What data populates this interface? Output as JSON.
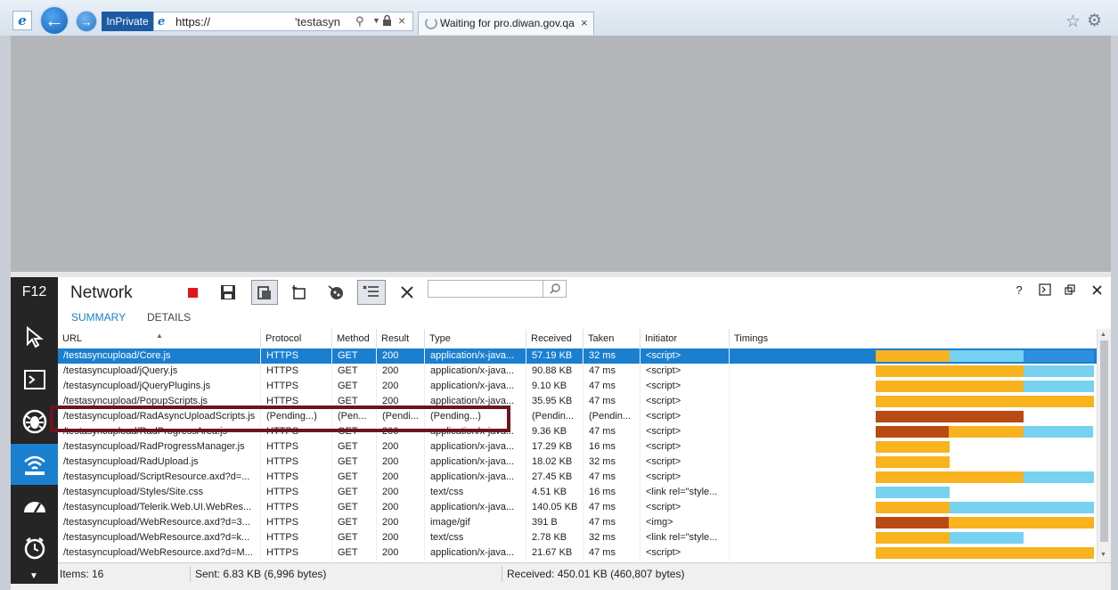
{
  "browser": {
    "url": "https://",
    "url_suffix": "'testasyncu",
    "inprivate_label": "InPrivate",
    "tab_title": "Waiting for pro.diwan.gov.qa",
    "tab_close": "×",
    "addr_close": "×"
  },
  "f12": {
    "label": "F12",
    "title": "Network",
    "help": "?",
    "subtabs": [
      "SUMMARY",
      "DETAILS"
    ],
    "columns": [
      "URL",
      "Protocol",
      "Method",
      "Result",
      "Type",
      "Received",
      "Taken",
      "Initiator",
      "Timings"
    ],
    "rows": [
      {
        "url": "/testasyncupload/Core.js",
        "protocol": "HTTPS",
        "method": "GET",
        "result": "200",
        "type": "application/x-java...",
        "received": "57.19 KB",
        "taken": "32 ms",
        "initiator": "<script>"
      },
      {
        "url": "/testasyncupload/jQuery.js",
        "protocol": "HTTPS",
        "method": "GET",
        "result": "200",
        "type": "application/x-java...",
        "received": "90.88 KB",
        "taken": "47 ms",
        "initiator": "<script>"
      },
      {
        "url": "/testasyncupload/jQueryPlugins.js",
        "protocol": "HTTPS",
        "method": "GET",
        "result": "200",
        "type": "application/x-java...",
        "received": "9.10 KB",
        "taken": "47 ms",
        "initiator": "<script>"
      },
      {
        "url": "/testasyncupload/PopupScripts.js",
        "protocol": "HTTPS",
        "method": "GET",
        "result": "200",
        "type": "application/x-java...",
        "received": "35.95 KB",
        "taken": "47 ms",
        "initiator": "<script>"
      },
      {
        "url": "/testasyncupload/RadAsyncUploadScripts.js",
        "protocol": "(Pending...)",
        "method": "(Pen...",
        "result": "(Pendi...",
        "type": "(Pending...)",
        "received": "(Pendin...",
        "taken": "(Pendin...",
        "initiator": "<script>"
      },
      {
        "url": "/testasyncupload/RadProgressArea.js",
        "protocol": "HTTPS",
        "method": "GET",
        "result": "200",
        "type": "application/x-java...",
        "received": "9.36 KB",
        "taken": "47 ms",
        "initiator": "<script>"
      },
      {
        "url": "/testasyncupload/RadProgressManager.js",
        "protocol": "HTTPS",
        "method": "GET",
        "result": "200",
        "type": "application/x-java...",
        "received": "17.29 KB",
        "taken": "16 ms",
        "initiator": "<script>"
      },
      {
        "url": "/testasyncupload/RadUpload.js",
        "protocol": "HTTPS",
        "method": "GET",
        "result": "200",
        "type": "application/x-java...",
        "received": "18.02 KB",
        "taken": "32 ms",
        "initiator": "<script>"
      },
      {
        "url": "/testasyncupload/ScriptResource.axd?d=...",
        "protocol": "HTTPS",
        "method": "GET",
        "result": "200",
        "type": "application/x-java...",
        "received": "27.45 KB",
        "taken": "47 ms",
        "initiator": "<script>"
      },
      {
        "url": "/testasyncupload/Styles/Site.css",
        "protocol": "HTTPS",
        "method": "GET",
        "result": "200",
        "type": "text/css",
        "received": "4.51 KB",
        "taken": "16 ms",
        "initiator": "<link rel=\"style..."
      },
      {
        "url": "/testasyncupload/Telerik.Web.UI.WebRes...",
        "protocol": "HTTPS",
        "method": "GET",
        "result": "200",
        "type": "application/x-java...",
        "received": "140.05 KB",
        "taken": "47 ms",
        "initiator": "<script>"
      },
      {
        "url": "/testasyncupload/WebResource.axd?d=3...",
        "protocol": "HTTPS",
        "method": "GET",
        "result": "200",
        "type": "image/gif",
        "received": "391 B",
        "taken": "47 ms",
        "initiator": "<img>"
      },
      {
        "url": "/testasyncupload/WebResource.axd?d=k...",
        "protocol": "HTTPS",
        "method": "GET",
        "result": "200",
        "type": "text/css",
        "received": "2.78 KB",
        "taken": "32 ms",
        "initiator": "<link rel=\"style..."
      },
      {
        "url": "/testasyncupload/WebResource.axd?d=M...",
        "protocol": "HTTPS",
        "method": "GET",
        "result": "200",
        "type": "application/x-java...",
        "received": "21.67 KB",
        "taken": "47 ms",
        "initiator": "<script>"
      }
    ],
    "timing_colors": {
      "orange": "#f8b31f",
      "blue": "#76d2f0",
      "rust": "#b84a12",
      "selected_bg": "#1b7fd0"
    },
    "status": {
      "items": "Items: 16",
      "sent": "Sent: 6.83 KB (6,996 bytes)",
      "received": "Received: 450.01 KB (460,807 bytes)"
    }
  }
}
